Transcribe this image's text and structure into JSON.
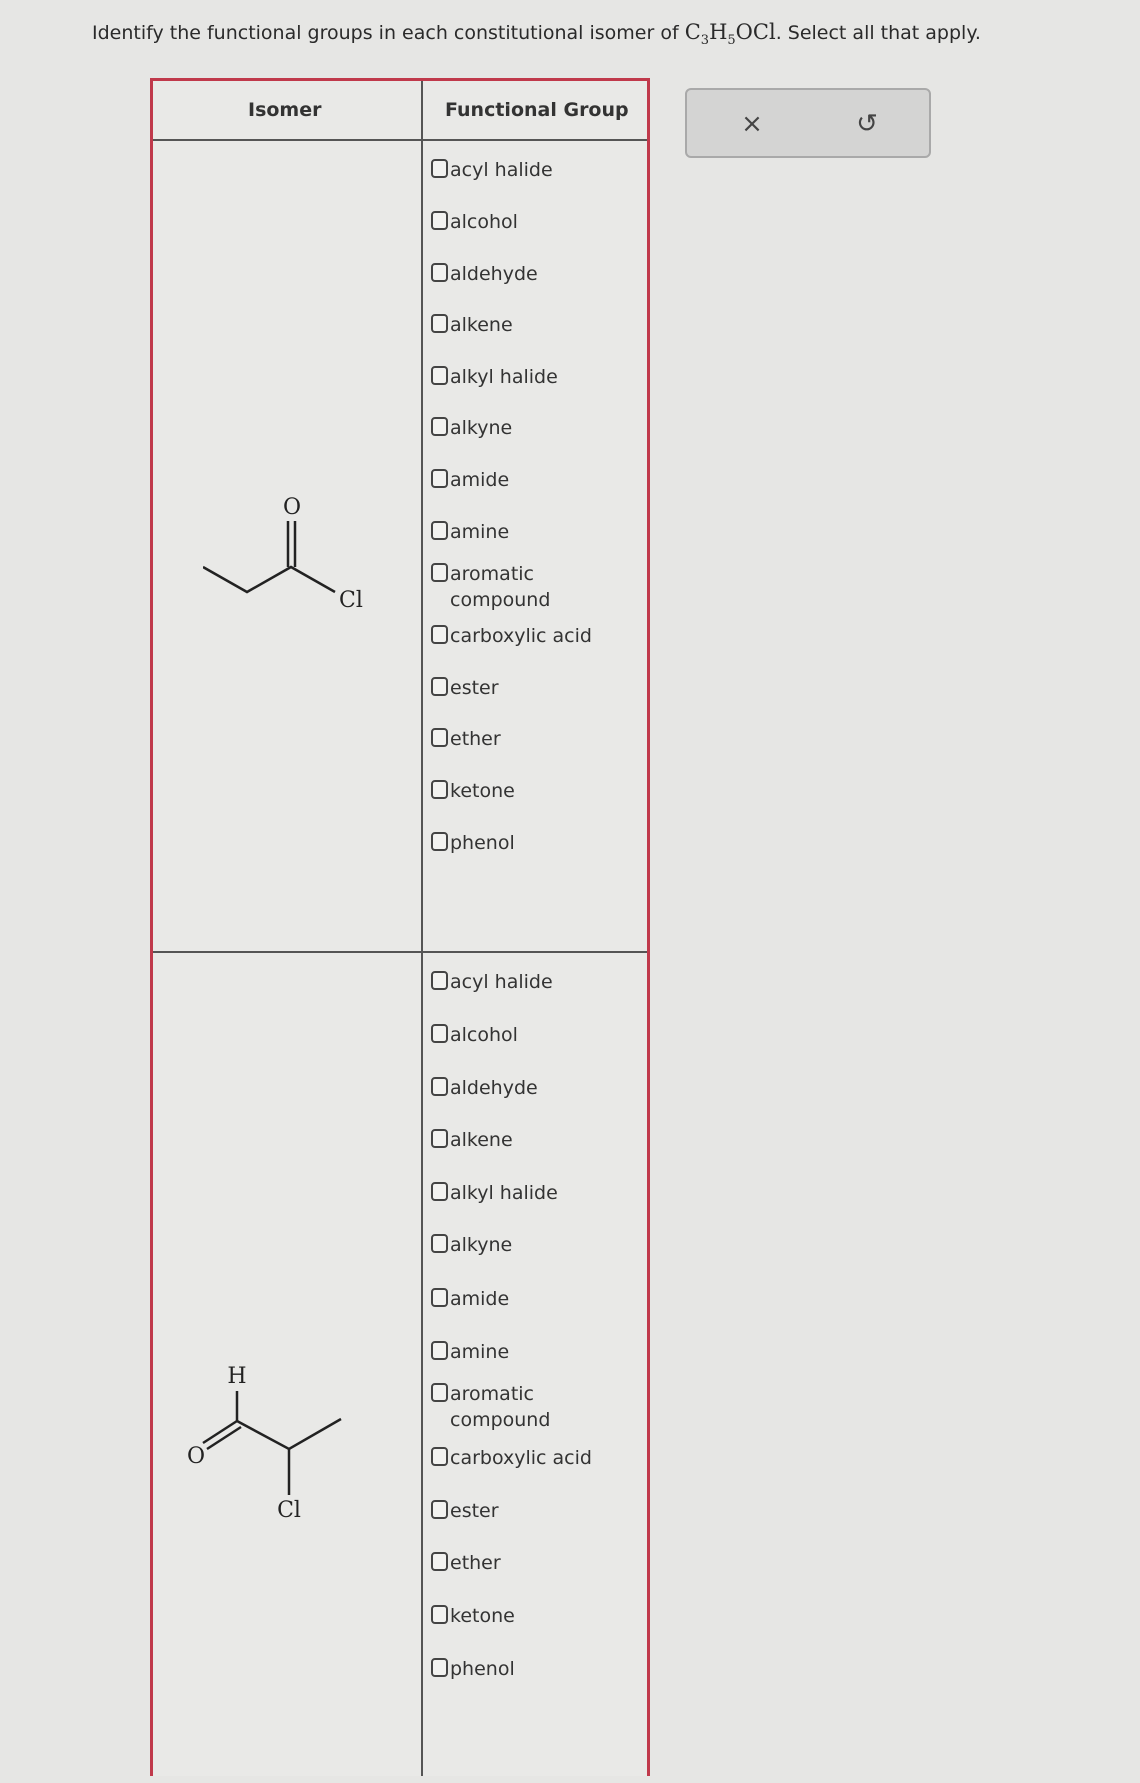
{
  "prompt": {
    "text_before": "Identify the functional groups in each constitutional isomer of ",
    "formula": {
      "c": "C",
      "c_n": "3",
      "h": "H",
      "h_n": "5",
      "rest": "OCl"
    },
    "text_after": ". Select all that apply."
  },
  "table": {
    "headers": {
      "isomer": "Isomer",
      "functional_group": "Functional Group"
    },
    "rows": [
      {
        "structure": {
          "atoms": [
            "O",
            "Cl"
          ]
        },
        "options": [
          {
            "label": "acyl halide",
            "checked": false
          },
          {
            "label": "alcohol",
            "checked": false
          },
          {
            "label": "aldehyde",
            "checked": false
          },
          {
            "label": "alkene",
            "checked": false
          },
          {
            "label": "alkyl halide",
            "checked": false
          },
          {
            "label": "alkyne",
            "checked": false
          },
          {
            "label": "amide",
            "checked": false
          },
          {
            "label": "amine",
            "checked": false
          },
          {
            "label": "aromatic compound",
            "checked": false
          },
          {
            "label": "carboxylic acid",
            "checked": false
          },
          {
            "label": "ester",
            "checked": false
          },
          {
            "label": "ether",
            "checked": false
          },
          {
            "label": "ketone",
            "checked": false
          },
          {
            "label": "phenol",
            "checked": false
          }
        ]
      },
      {
        "structure": {
          "atoms": [
            "H",
            "O",
            "Cl"
          ]
        },
        "options": [
          {
            "label": "acyl halide",
            "checked": false
          },
          {
            "label": "alcohol",
            "checked": false
          },
          {
            "label": "aldehyde",
            "checked": false
          },
          {
            "label": "alkene",
            "checked": false
          },
          {
            "label": "alkyl halide",
            "checked": false
          },
          {
            "label": "alkyne",
            "checked": false
          },
          {
            "label": "amide",
            "checked": false
          },
          {
            "label": "amine",
            "checked": false
          },
          {
            "label": "aromatic compound",
            "checked": false
          },
          {
            "label": "carboxylic acid",
            "checked": false
          },
          {
            "label": "ester",
            "checked": false
          },
          {
            "label": "ether",
            "checked": false
          },
          {
            "label": "ketone",
            "checked": false
          },
          {
            "label": "phenol",
            "checked": false
          }
        ]
      }
    ]
  },
  "toolbar": {
    "clear_icon": "x-icon",
    "clear_glyph": "×",
    "undo_icon": "undo-icon",
    "undo_glyph": "↺"
  }
}
